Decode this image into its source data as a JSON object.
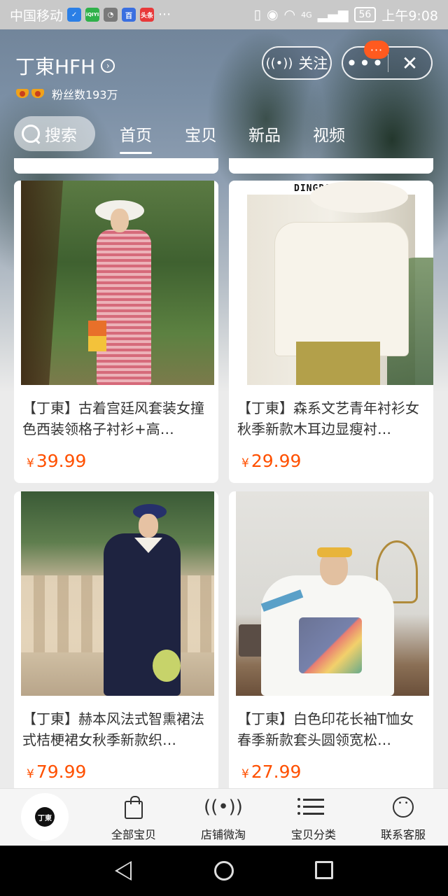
{
  "status_bar": {
    "carrier": "中国移动",
    "apps": [
      {
        "name": "shield-app-icon",
        "color": "#2b7fe6",
        "label": "✓"
      },
      {
        "name": "iqiyi-app-icon",
        "color": "#2fb14a",
        "label": "iQIYI"
      },
      {
        "name": "qq-app-icon",
        "color": "#5a5a5a",
        "label": "◔"
      },
      {
        "name": "baidu-app-icon",
        "color": "#3a6fe0",
        "label": "百"
      },
      {
        "name": "toutiao-app-icon",
        "color": "#e8393a",
        "label": "头条"
      }
    ],
    "more": "···",
    "network": "4G",
    "battery": "56",
    "time": "上午9:08"
  },
  "header": {
    "shop_name": "丁東HFH",
    "fans": "粉丝数193万",
    "follow_label": "关注",
    "more_glyph": "•••",
    "badge_glyph": "···",
    "close_glyph": "✕"
  },
  "tabs": {
    "search": "搜索",
    "items": [
      "首页",
      "宝贝",
      "新品",
      "视频"
    ],
    "active_index": 0
  },
  "products": [
    {
      "title": "【丁東】古着宫廷风套装女撞色西装领格子衬衫+高…",
      "currency": "¥",
      "price": "39.99"
    },
    {
      "title": "【丁東】森系文艺青年衬衫女秋季新款木耳边显瘦衬…",
      "currency": "¥",
      "price": "29.99",
      "brand_text": "DINGDONG HFH"
    },
    {
      "title": "【丁東】赫本风法式智熏裙法式桔梗裙女秋季新款织…",
      "currency": "¥",
      "price": "79.99"
    },
    {
      "title": "【丁東】白色印花长袖T恤女春季新款套头圆领宽松…",
      "currency": "¥",
      "price": "27.99"
    }
  ],
  "bottom_bar": {
    "logo_text": "丁東",
    "items": [
      {
        "label": "全部宝贝",
        "icon": "shopping-bag-icon"
      },
      {
        "label": "店铺微淘",
        "icon": "broadcast-icon"
      },
      {
        "label": "宝贝分类",
        "icon": "list-icon"
      },
      {
        "label": "联系客服",
        "icon": "chat-icon"
      }
    ]
  },
  "colors": {
    "price": "#ff5000",
    "badge": "#ff5a1f",
    "text": "#333333"
  }
}
